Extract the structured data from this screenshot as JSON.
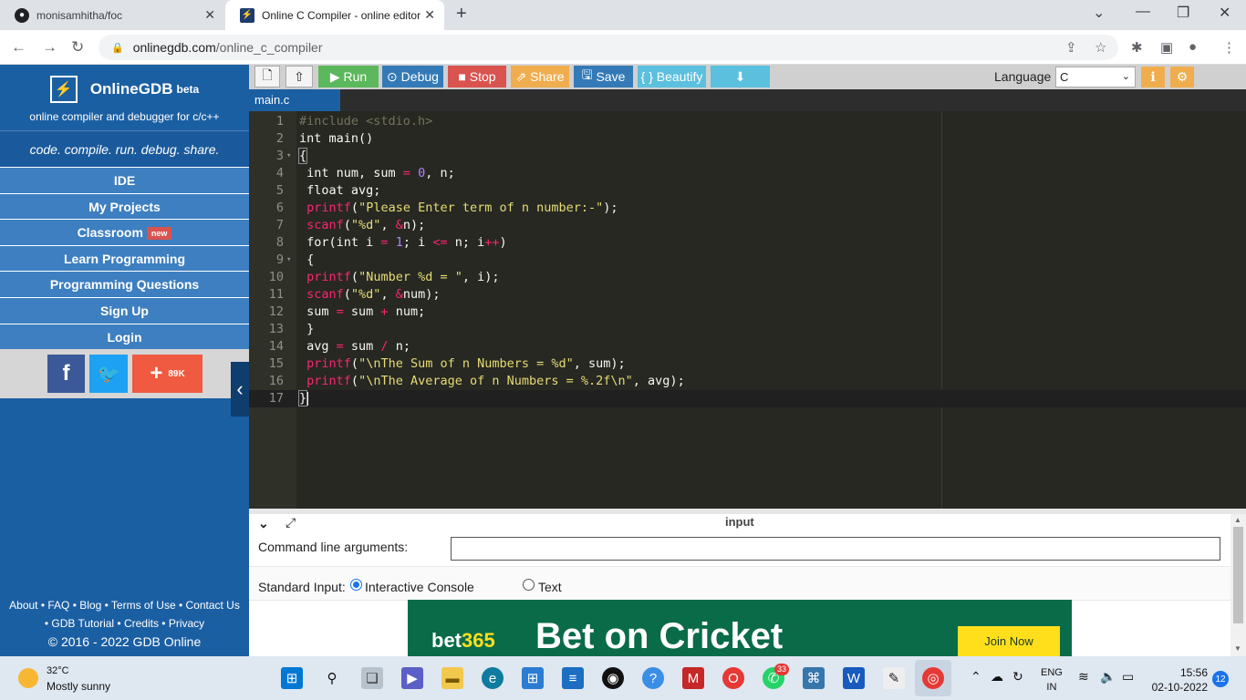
{
  "browser": {
    "tabs": [
      {
        "title": "monisamhitha/foc",
        "icon": "github-icon"
      },
      {
        "title": "Online C Compiler - online editor",
        "icon": "onlinegdb-icon"
      }
    ],
    "url_host": "onlinegdb.com",
    "url_path": "/online_c_compiler"
  },
  "sidebar": {
    "logo_name": "OnlineGDB",
    "logo_beta": "beta",
    "logo_sub": "online compiler and debugger for c/c++",
    "tagline": "code. compile. run. debug. share.",
    "items": [
      {
        "label": "IDE"
      },
      {
        "label": "My Projects"
      },
      {
        "label": "Classroom",
        "badge": "new"
      },
      {
        "label": "Learn Programming"
      },
      {
        "label": "Programming Questions"
      },
      {
        "label": "Sign Up"
      },
      {
        "label": "Login"
      }
    ],
    "social": {
      "plus_count": "89K"
    },
    "footer": {
      "line1": "About • FAQ • Blog • Terms of Use • Contact Us",
      "line2": "• GDB Tutorial • Credits • Privacy",
      "copyright": "© 2016 - 2022 GDB Online"
    }
  },
  "toolbar": {
    "run": "Run",
    "debug": "Debug",
    "stop": "Stop",
    "share": "Share",
    "save": "Save",
    "beautify": "{ } Beautify",
    "language_label": "Language",
    "language_value": "C"
  },
  "editor": {
    "file_tab": "main.c",
    "lines": [
      "#include <stdio.h>",
      "int main()",
      "{",
      " int num, sum = 0, n;",
      " float avg;",
      " printf(\"Please Enter term of n number:-\");",
      " scanf(\"%d\", &n);",
      " for(int i = 1; i <= n; i++)",
      " {",
      " printf(\"Number %d = \", i);",
      " scanf(\"%d\", &num);",
      " sum = sum + num;",
      " }",
      " avg = sum / n;",
      " printf(\"\\nThe Sum of n Numbers = %d\", sum);",
      " printf(\"\\nThe Average of n Numbers = %.2f\\n\", avg);",
      "}"
    ]
  },
  "input_panel": {
    "title": "input",
    "cmd_label": "Command line arguments:",
    "std_label": "Standard Input:",
    "option_interactive": "Interactive Console",
    "option_text": "Text",
    "selected": "Interactive Console"
  },
  "ad": {
    "brand_a": "bet",
    "brand_b": "365",
    "headline": "Bet on Cricket",
    "cta": "Join Now"
  },
  "taskbar": {
    "temperature": "32°C",
    "weather": "Mostly sunny",
    "lang_1": "ENG",
    "lang_2": "IN",
    "time": "15:56",
    "date": "02-10-2022",
    "notifications": "12",
    "whatsapp_badge": "33"
  }
}
